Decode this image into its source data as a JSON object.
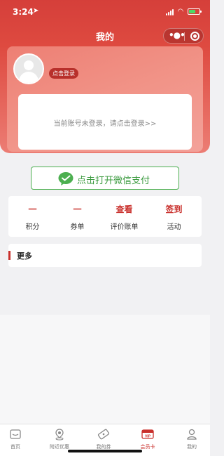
{
  "status_bar": {
    "time": "3:24"
  },
  "nav": {
    "title": "我的",
    "more_glyph": "•●•"
  },
  "profile": {
    "login_badge": "点击登录",
    "notice": "当前账号未登录，请点击登录>>"
  },
  "pay": {
    "label": "点击打开微信支付"
  },
  "stats": [
    {
      "value": "一",
      "label": "积分"
    },
    {
      "value": "一",
      "label": "券单"
    },
    {
      "value": "查看",
      "label": "评价账单"
    },
    {
      "value": "签到",
      "label": "活动"
    }
  ],
  "more": {
    "title": "更多"
  },
  "tabs": [
    {
      "label": "首页",
      "icon": "home-icon",
      "active": false
    },
    {
      "label": "附近优惠",
      "icon": "location-icon",
      "active": false
    },
    {
      "label": "我的券",
      "icon": "ticket-icon",
      "active": false
    },
    {
      "label": "会员卡",
      "icon": "vip-card-icon",
      "active": true
    },
    {
      "label": "我的",
      "icon": "user-icon",
      "active": false
    }
  ],
  "colors": {
    "brand_red": "#c9302c",
    "wechat_green": "#4caf50"
  }
}
